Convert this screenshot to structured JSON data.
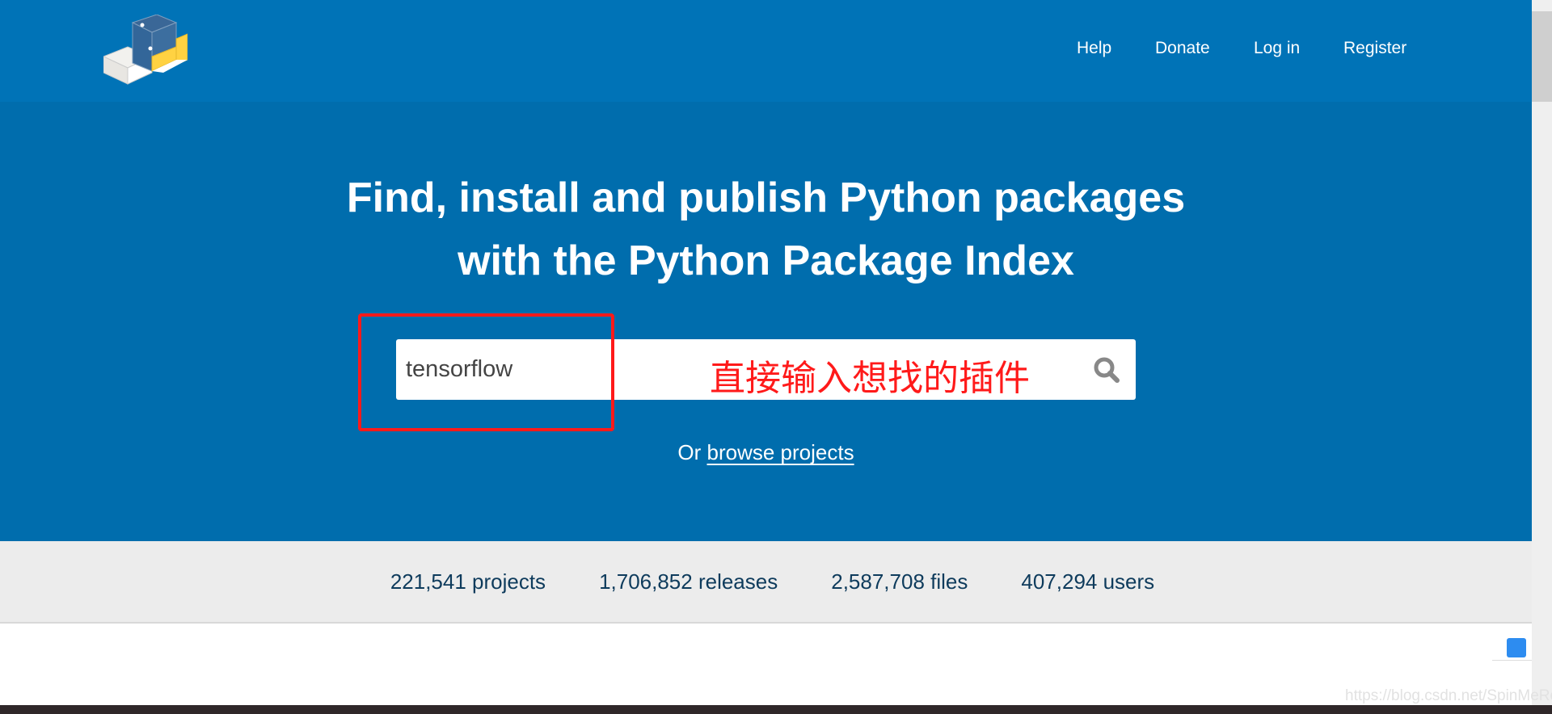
{
  "header": {
    "logo": "pypi-logo",
    "nav": [
      "Help",
      "Donate",
      "Log in",
      "Register"
    ]
  },
  "hero": {
    "title_line1": "Find, install and publish Python packages",
    "title_line2": "with the Python Package Index",
    "search": {
      "value": "tensorflow",
      "icon": "search-icon"
    },
    "annotation": "直接输入想找的插件",
    "browse_prefix": "Or",
    "browse_link": "browse projects"
  },
  "stats": [
    "221,541 projects",
    "1,706,852 releases",
    "2,587,708 files",
    "407,294 users"
  ],
  "watermark": "https://blog.csdn.net/SpinMeRound",
  "colors": {
    "header": "#0073b7",
    "hero": "#006dad",
    "annotation": "#ff1a1a"
  }
}
